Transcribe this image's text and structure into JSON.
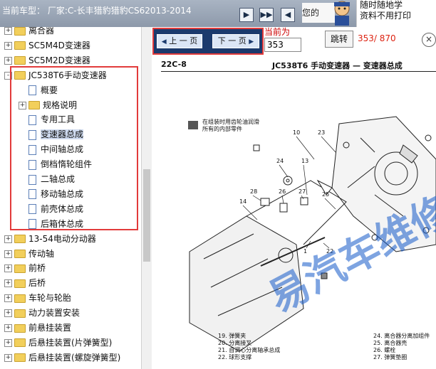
{
  "header": {
    "car_model": "当前车型： 厂家:C-长丰猎豹猎豹CS62013-2014",
    "nav_buttons": [
      "first-page",
      "next-chapter",
      "last-page"
    ],
    "ad_text": "您的",
    "ad_line1": "随时随地学",
    "ad_line2": "资料不用打印"
  },
  "tree": {
    "items": [
      {
        "label": "离合器",
        "level": 0,
        "type": "folder",
        "expander": "+"
      },
      {
        "label": "SC5M4D变速器",
        "level": 0,
        "type": "folder",
        "expander": "+"
      },
      {
        "label": "SC5M2D变速器",
        "level": 0,
        "type": "folder",
        "expander": "+"
      },
      {
        "label": "JC538T6手动变速器",
        "level": 0,
        "type": "folder",
        "expander": "-"
      },
      {
        "label": "概要",
        "level": 1,
        "type": "page",
        "expander": ""
      },
      {
        "label": "规格说明",
        "level": 1,
        "type": "folder",
        "expander": "+"
      },
      {
        "label": "专用工具",
        "level": 1,
        "type": "page",
        "expander": ""
      },
      {
        "label": "变速器总成",
        "level": 1,
        "type": "page",
        "expander": "",
        "selected": true
      },
      {
        "label": "中间轴总成",
        "level": 1,
        "type": "page",
        "expander": ""
      },
      {
        "label": "倒档惰轮组件",
        "level": 1,
        "type": "page",
        "expander": ""
      },
      {
        "label": "二轴总成",
        "level": 1,
        "type": "page",
        "expander": ""
      },
      {
        "label": "移动轴总成",
        "level": 1,
        "type": "page",
        "expander": ""
      },
      {
        "label": "前壳体总成",
        "level": 1,
        "type": "page",
        "expander": ""
      },
      {
        "label": "后箱体总成",
        "level": 1,
        "type": "page",
        "expander": ""
      },
      {
        "label": "13-54电动分动器",
        "level": 0,
        "type": "folder",
        "expander": "+"
      },
      {
        "label": "传动轴",
        "level": 0,
        "type": "folder",
        "expander": "+"
      },
      {
        "label": "前桥",
        "level": 0,
        "type": "folder",
        "expander": "+"
      },
      {
        "label": "后桥",
        "level": 0,
        "type": "folder",
        "expander": "+"
      },
      {
        "label": "车轮与轮胎",
        "level": 0,
        "type": "folder",
        "expander": "+"
      },
      {
        "label": "动力装置安装",
        "level": 0,
        "type": "folder",
        "expander": "+"
      },
      {
        "label": "前悬挂装置",
        "level": 0,
        "type": "folder",
        "expander": "+"
      },
      {
        "label": "后悬挂装置(片弹簧型)",
        "level": 0,
        "type": "folder",
        "expander": "+"
      },
      {
        "label": "后悬挂装置(螺旋弹簧型)",
        "level": 0,
        "type": "folder",
        "expander": "+"
      }
    ]
  },
  "pager": {
    "prev_label": "上 一 页",
    "next_label": "下 一 页",
    "current_label": "当前为",
    "page_value": "353",
    "jump_label": "跳转",
    "page_count": "353/ 870"
  },
  "document": {
    "section": "22C-8",
    "title": "JC538T6 手动变速器 — 变速器总成",
    "note_line1": "在组装时用齿轮油润滑",
    "note_line2": "所有的内部零件",
    "callouts": [
      "23",
      "10",
      "24",
      "13",
      "28",
      "26",
      "27",
      "14",
      "25",
      "1",
      "22"
    ],
    "legend_left": [
      "19. 弹簧夹",
      "20. 分离接叉",
      "21. 自调心分离轴承总成",
      "22. 球形支撑"
    ],
    "legend_right": [
      "24. 离合器分离加组件",
      "25. 离合器壳",
      "26. 螺栓",
      "27. 弹簧垫圈"
    ],
    "watermark": "易汽车维修平"
  },
  "colors": {
    "highlight_border": "#e23b3b",
    "nav_bar": "#1b3a6d",
    "topbar": "#97a3b3",
    "page_count": "#d21111"
  }
}
